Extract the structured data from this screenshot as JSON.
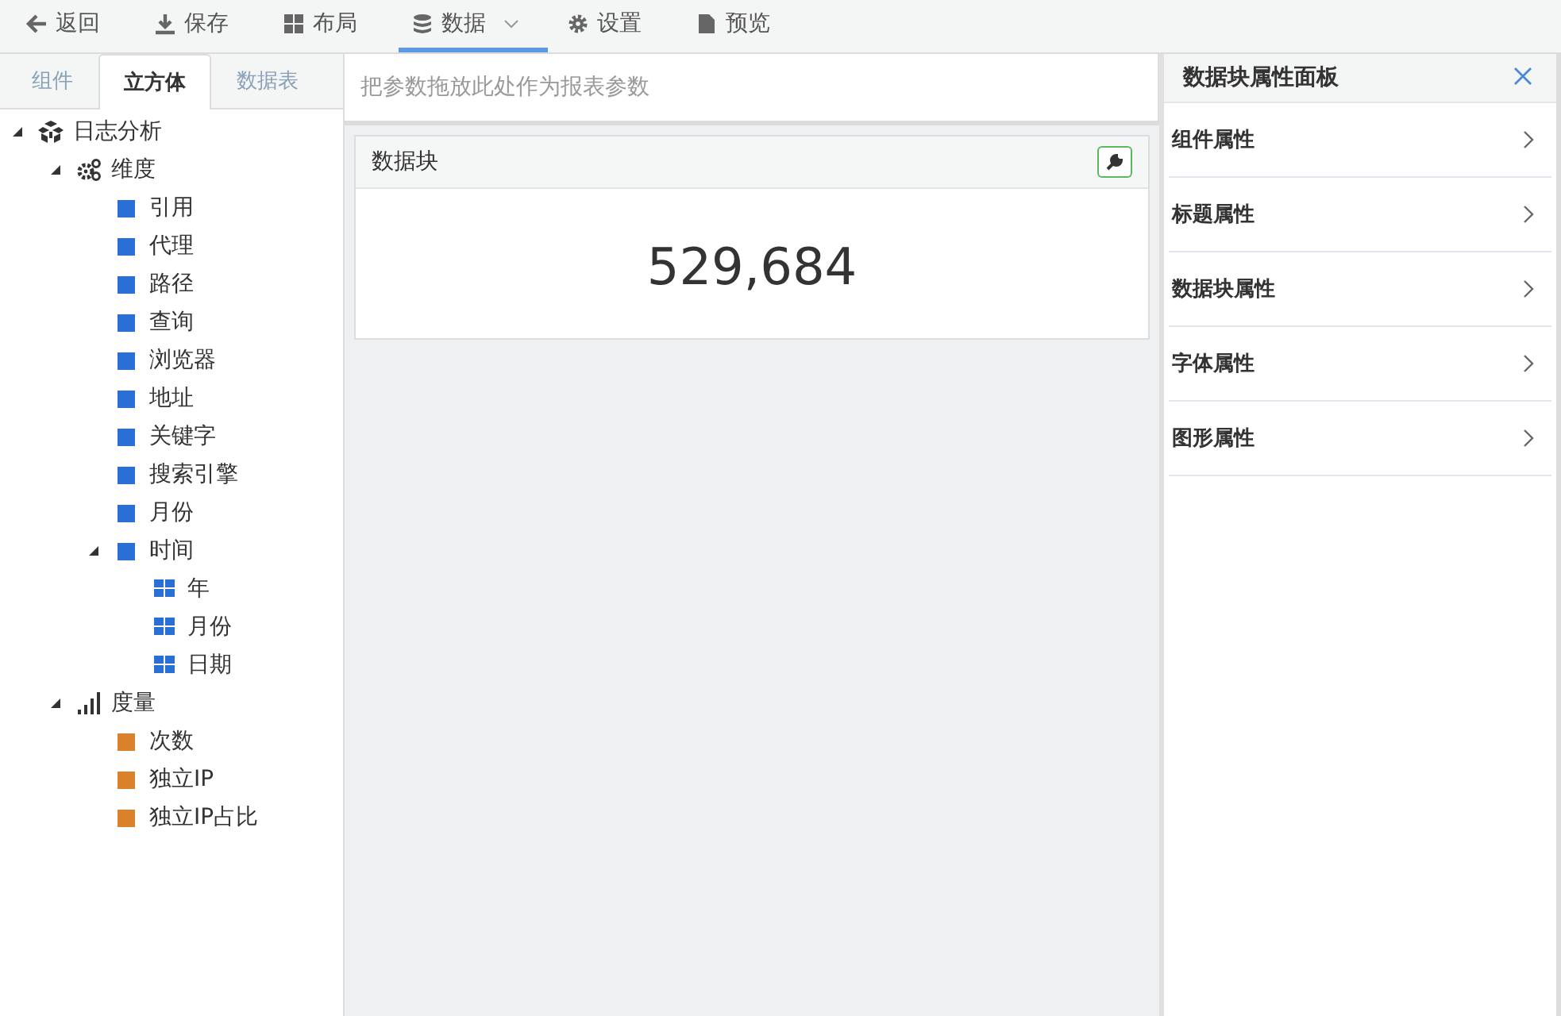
{
  "toolbar": [
    {
      "label": "返回",
      "selected": false,
      "dropdown": false
    },
    {
      "label": "保存",
      "selected": false,
      "dropdown": false
    },
    {
      "label": "布局",
      "selected": false,
      "dropdown": false
    },
    {
      "label": "数据",
      "selected": true,
      "dropdown": true
    },
    {
      "label": "设置",
      "selected": false,
      "dropdown": false
    },
    {
      "label": "预览",
      "selected": false,
      "dropdown": false
    }
  ],
  "sidebar": {
    "tabs": [
      {
        "label": "组件",
        "selected": false
      },
      {
        "label": "立方体",
        "selected": true
      },
      {
        "label": "数据表",
        "selected": false
      }
    ],
    "tree": [
      {
        "label": "日志分析",
        "kind": "cube",
        "expanded": true,
        "children": [
          {
            "label": "维度",
            "kind": "dimensions",
            "expanded": true,
            "children": [
              {
                "label": "引用",
                "kind": "dimension"
              },
              {
                "label": "代理",
                "kind": "dimension"
              },
              {
                "label": "路径",
                "kind": "dimension"
              },
              {
                "label": "查询",
                "kind": "dimension"
              },
              {
                "label": "浏览器",
                "kind": "dimension"
              },
              {
                "label": "地址",
                "kind": "dimension"
              },
              {
                "label": "关键字",
                "kind": "dimension"
              },
              {
                "label": "搜索引擎",
                "kind": "dimension"
              },
              {
                "label": "月份",
                "kind": "dimension"
              },
              {
                "label": "时间",
                "kind": "dimension",
                "expanded": true,
                "children": [
                  {
                    "label": "年",
                    "kind": "level"
                  },
                  {
                    "label": "月份",
                    "kind": "level"
                  },
                  {
                    "label": "日期",
                    "kind": "level"
                  }
                ]
              }
            ]
          },
          {
            "label": "度量",
            "kind": "measures",
            "expanded": true,
            "children": [
              {
                "label": "次数",
                "kind": "measure"
              },
              {
                "label": "独立IP",
                "kind": "measure"
              },
              {
                "label": "独立IP占比",
                "kind": "measure"
              }
            ]
          }
        ]
      }
    ]
  },
  "parameter_bar": {
    "placeholder": "把参数拖放此处作为报表参数"
  },
  "data_block": {
    "title": "数据块",
    "value": "529,684"
  },
  "properties_panel": {
    "title": "数据块属性面板",
    "items": [
      "组件属性",
      "标题属性",
      "数据块属性",
      "字体属性",
      "图形属性"
    ]
  }
}
